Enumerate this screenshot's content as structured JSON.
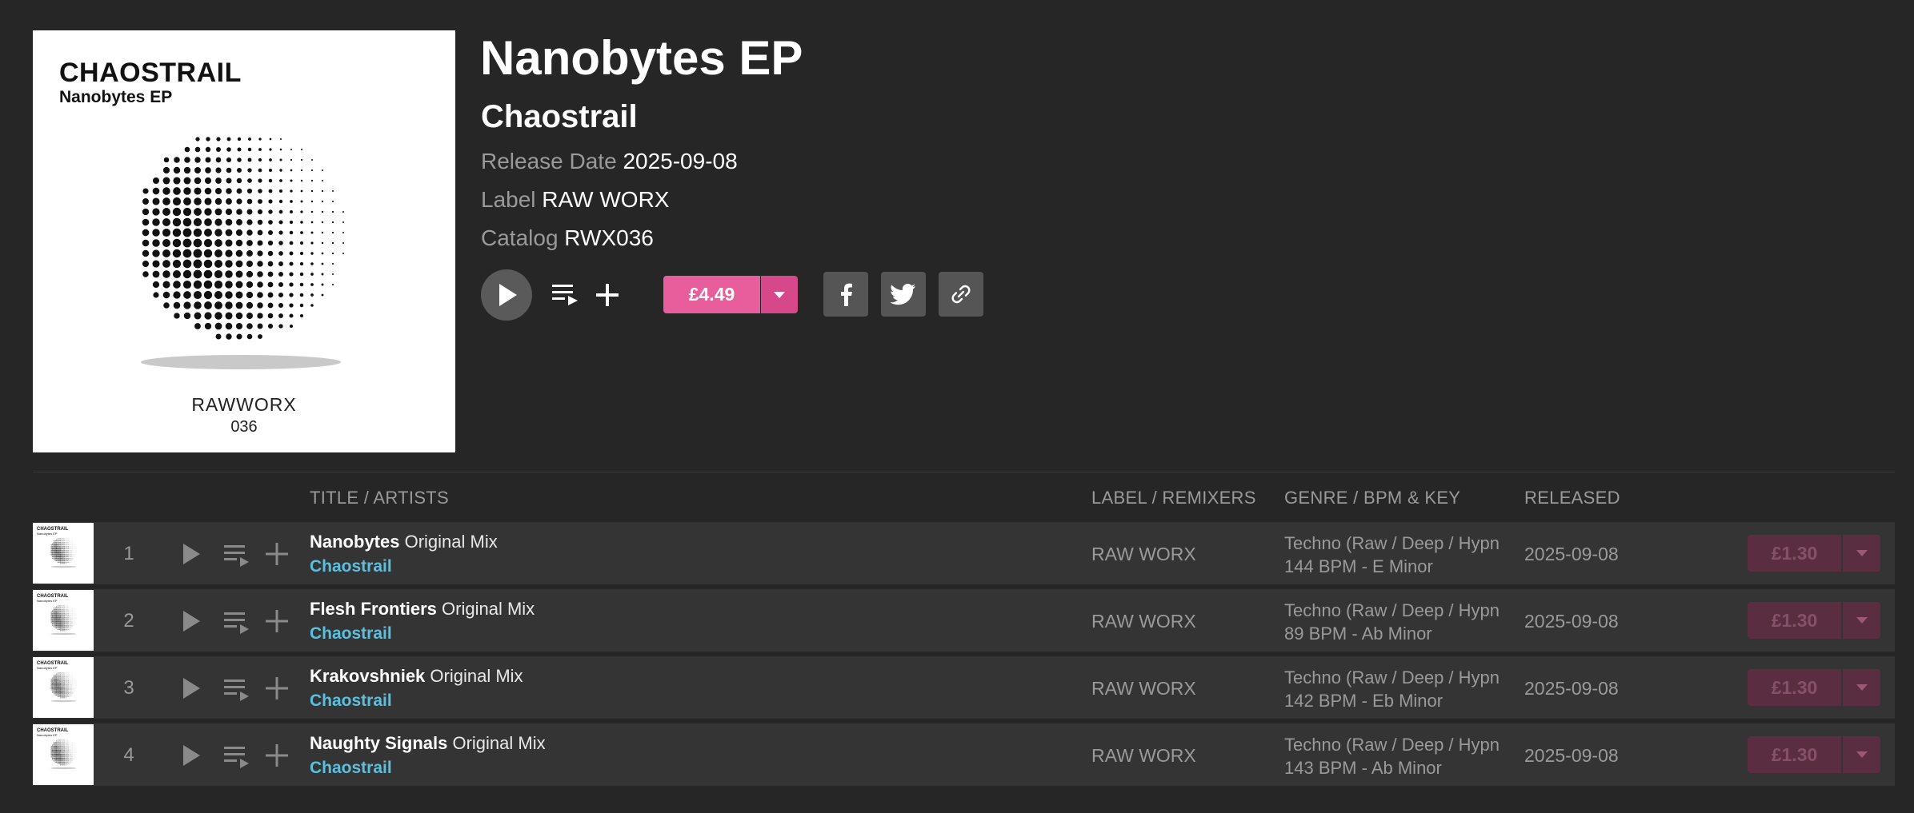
{
  "release": {
    "cover_title": "CHAOSTRAIL",
    "cover_subtitle": "Nanobytes EP",
    "cover_logo": "RAWWORX",
    "cover_catalog": "036",
    "title": "Nanobytes EP",
    "artist": "Chaostrail",
    "release_date_label": "Release Date",
    "release_date": "2025-09-08",
    "label_label": "Label",
    "label": "RAW WORX",
    "catalog_label": "Catalog",
    "catalog": "RWX036",
    "price": "£4.49"
  },
  "icons": [
    "play-icon",
    "add-to-queue-icon",
    "plus-icon",
    "caret-down-icon",
    "facebook-icon",
    "twitter-icon",
    "link-icon"
  ],
  "colors": {
    "background": "#262626",
    "row_background": "#343434",
    "accent_pink": "#e85d9c",
    "artist_link": "#5bc0de",
    "muted_text": "#9a9a9a",
    "disabled_buy": "#5a2e40"
  },
  "table": {
    "headers": {
      "title": "TITLE / ARTISTS",
      "label": "LABEL / REMIXERS",
      "genre": "GENRE / BPM & KEY",
      "released": "RELEASED"
    },
    "tracks": [
      {
        "num": "1",
        "title": "Nanobytes",
        "mix": "Original Mix",
        "artist": "Chaostrail",
        "label": "RAW WORX",
        "genre": "Techno (Raw / Deep / Hypnotic)",
        "bpm_key": "144 BPM - E Minor",
        "released": "2025-09-08",
        "price": "£1.30"
      },
      {
        "num": "2",
        "title": "Flesh Frontiers",
        "mix": "Original Mix",
        "artist": "Chaostrail",
        "label": "RAW WORX",
        "genre": "Techno (Raw / Deep / Hypnotic)",
        "bpm_key": "89 BPM - Ab Minor",
        "released": "2025-09-08",
        "price": "£1.30"
      },
      {
        "num": "3",
        "title": "Krakovshniek",
        "mix": "Original Mix",
        "artist": "Chaostrail",
        "label": "RAW WORX",
        "genre": "Techno (Raw / Deep / Hypnotic)",
        "bpm_key": "142 BPM - Eb Minor",
        "released": "2025-09-08",
        "price": "£1.30"
      },
      {
        "num": "4",
        "title": "Naughty Signals",
        "mix": "Original Mix",
        "artist": "Chaostrail",
        "label": "RAW WORX",
        "genre": "Techno (Raw / Deep / Hypnotic)",
        "bpm_key": "143 BPM - Ab Minor",
        "released": "2025-09-08",
        "price": "£1.30"
      }
    ]
  }
}
